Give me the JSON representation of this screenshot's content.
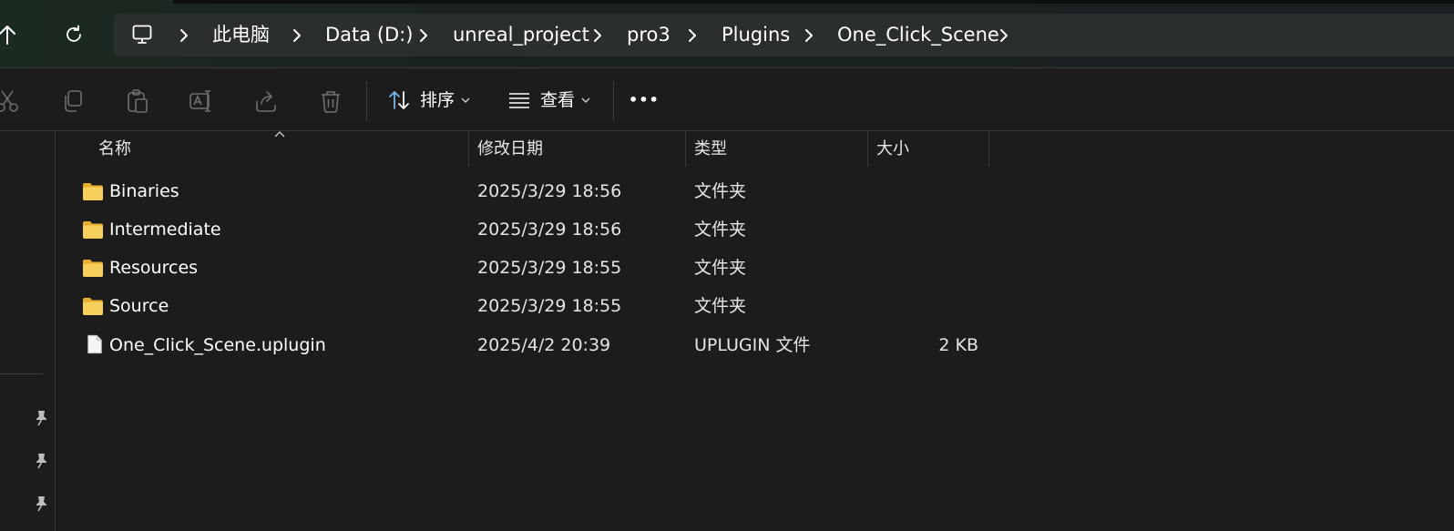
{
  "address_bar": {
    "crumbs": [
      "此电脑",
      "Data (D:)",
      "unreal_project",
      "pro3",
      "Plugins",
      "One_Click_Scene"
    ]
  },
  "toolbar": {
    "sort_label": "排序",
    "view_label": "查看",
    "more_label": "•••"
  },
  "columns": {
    "name": "名称",
    "date": "修改日期",
    "type": "类型",
    "size": "大小"
  },
  "files": [
    {
      "name": "Binaries",
      "date": "2025/3/29 18:56",
      "type": "文件夹",
      "size": "",
      "icon": "folder-icon"
    },
    {
      "name": "Intermediate",
      "date": "2025/3/29 18:56",
      "type": "文件夹",
      "size": "",
      "icon": "folder-icon"
    },
    {
      "name": "Resources",
      "date": "2025/3/29 18:55",
      "type": "文件夹",
      "size": "",
      "icon": "folder-icon"
    },
    {
      "name": "Source",
      "date": "2025/3/29 18:55",
      "type": "文件夹",
      "size": "",
      "icon": "folder-icon"
    },
    {
      "name": "One_Click_Scene.uplugin",
      "date": "2025/4/2 20:39",
      "type": "UPLUGIN 文件",
      "size": "2 KB",
      "icon": "file-icon"
    }
  ],
  "colors": {
    "background": "#1c1c1c",
    "folder": "#f3c54b",
    "text": "#ffffff"
  }
}
